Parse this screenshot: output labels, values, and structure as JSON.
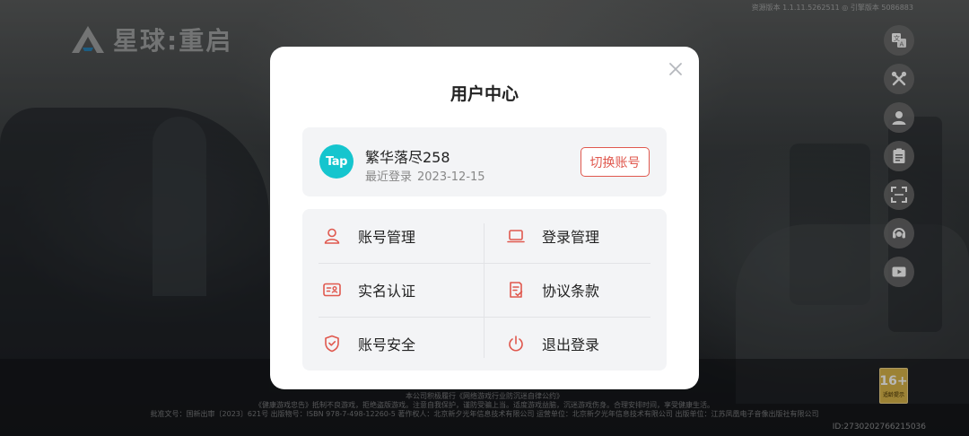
{
  "game": {
    "logo_text": "星球:重启",
    "version_text": "资源版本 1.1.11.5262511 ◎ 引擎版本 5086883",
    "age_rating": {
      "number": "16+",
      "label": "适龄提示"
    },
    "footer": {
      "line1": "本公司积极履行《网络游戏行业防沉迷自律公约》",
      "line2": "《健康游戏忠告》抵制不良游戏，拒绝盗版游戏。注意自我保护，谨防受骗上当。适度游戏益脑，沉迷游戏伤身。合理安排时间，享受健康生活。",
      "line3": "批准文号：国新出审〔2023〕621号  出版物号：ISBN 978-7-498-12260-5  著作权人：北京新夕光年信息技术有限公司  运营单位：北京新夕光年信息技术有限公司  出版单位：江苏凤凰电子音像出版社有限公司"
    },
    "device_id": "ID:27302027662150​36",
    "side_icons": [
      {
        "name": "translate-icon"
      },
      {
        "name": "tools-icon"
      },
      {
        "name": "user-icon"
      },
      {
        "name": "notice-icon"
      },
      {
        "name": "scan-icon"
      },
      {
        "name": "headset-icon"
      },
      {
        "name": "video-icon"
      }
    ]
  },
  "modal": {
    "title": "用户中心",
    "account": {
      "avatar_text": "Tap",
      "username": "繁华落尽258",
      "last_login_label": "最近登录",
      "last_login_date": "2023-12-15",
      "switch_label": "切换账号"
    },
    "menu": {
      "account_manage": "账号管理",
      "login_manage": "登录管理",
      "realname": "实名认证",
      "agreement": "协议条款",
      "account_security": "账号安全",
      "logout": "退出登录"
    }
  },
  "colors": {
    "accent": "#e0584e",
    "tap_brand": "#15c5ce",
    "card_bg": "#f3f4f6"
  }
}
